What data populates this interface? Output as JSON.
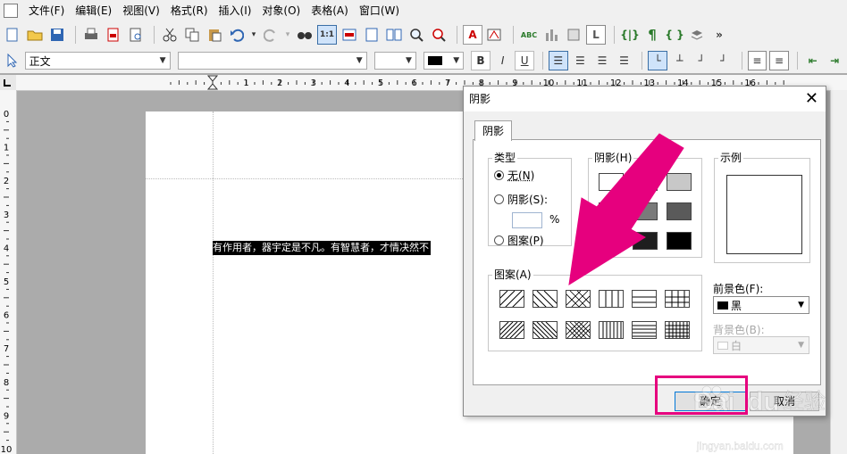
{
  "menubar": {
    "items": [
      "文件(F)",
      "编辑(E)",
      "视图(V)",
      "格式(R)",
      "插入(I)",
      "对象(O)",
      "表格(A)",
      "窗口(W)"
    ]
  },
  "toolbar": {
    "style_value": "正文",
    "font_value": "",
    "size_value": "",
    "more": "»"
  },
  "ruler": {
    "h_labels": [
      "1",
      "2",
      "3",
      "4",
      "5",
      "6",
      "7",
      "8",
      "9",
      "10",
      "11",
      "12",
      "13",
      "14",
      "15",
      "16"
    ],
    "v_labels": [
      "0",
      "1",
      "2",
      "3",
      "4",
      "5",
      "6",
      "7",
      "8",
      "9",
      "10"
    ]
  },
  "document": {
    "selected_text": "有作用者，器宇定是不凡。有智慧者，才情决然不"
  },
  "dialog": {
    "title": "阴影",
    "close": "✕",
    "tab": "阴影",
    "type_group": {
      "title": "类型",
      "none": "无(N)",
      "shadow": "阴影(S):",
      "percent": "%",
      "pattern": "图案(P)",
      "selected": "none"
    },
    "shade_group": {
      "title": "阴影(H)"
    },
    "sample_group": {
      "title": "示例"
    },
    "pattern_group": {
      "title": "图案(A)"
    },
    "foreground": {
      "label": "前景色(F):",
      "value": "黑",
      "color": "#000000"
    },
    "background": {
      "label": "背景色(B):",
      "value": "白",
      "color": "#ffffff"
    },
    "ok": "确定",
    "cancel": "取消"
  },
  "annotation": {
    "color": "#e6007e"
  },
  "watermark": {
    "brand": "Bai",
    "brand2": "du",
    "cn": "经验",
    "url": "jingyan.baidu.com"
  }
}
